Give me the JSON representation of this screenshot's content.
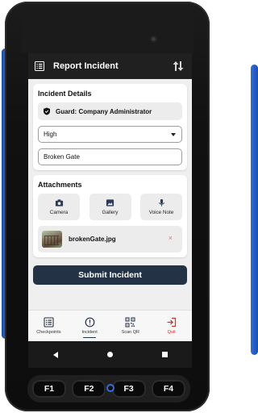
{
  "appbar": {
    "title": "Report Incident",
    "menu_icon": "list-icon",
    "sort_icon": "swap-vert-icon"
  },
  "incident_details": {
    "title": "Incident Details",
    "guard_label": "Guard: Company Administrator",
    "priority_value": "High",
    "description_value": "Broken Gate"
  },
  "attachments": {
    "title": "Attachments",
    "buttons": [
      {
        "label": "Camera",
        "icon": "camera-icon"
      },
      {
        "label": "Gallery",
        "icon": "gallery-icon"
      },
      {
        "label": "Voice Note",
        "icon": "mic-icon"
      }
    ],
    "files": [
      {
        "name": "brokenGate.jpg",
        "remove": "×"
      }
    ]
  },
  "submit_label": "Submit Incident",
  "bottom_nav": [
    {
      "label": "Checkpoints",
      "icon": "checklist-icon"
    },
    {
      "label": "Incident",
      "icon": "alert-circle-icon",
      "active": true
    },
    {
      "label": "Scan QR",
      "icon": "qr-code-icon"
    },
    {
      "label": "Quit",
      "icon": "logout-icon"
    }
  ],
  "fkeys": [
    "F1",
    "F2",
    "F3",
    "F4"
  ],
  "colors": {
    "appbar": "#202020",
    "submit": "#243246",
    "quit": "#d32f2f",
    "device_accent": "#2f6fe0"
  }
}
